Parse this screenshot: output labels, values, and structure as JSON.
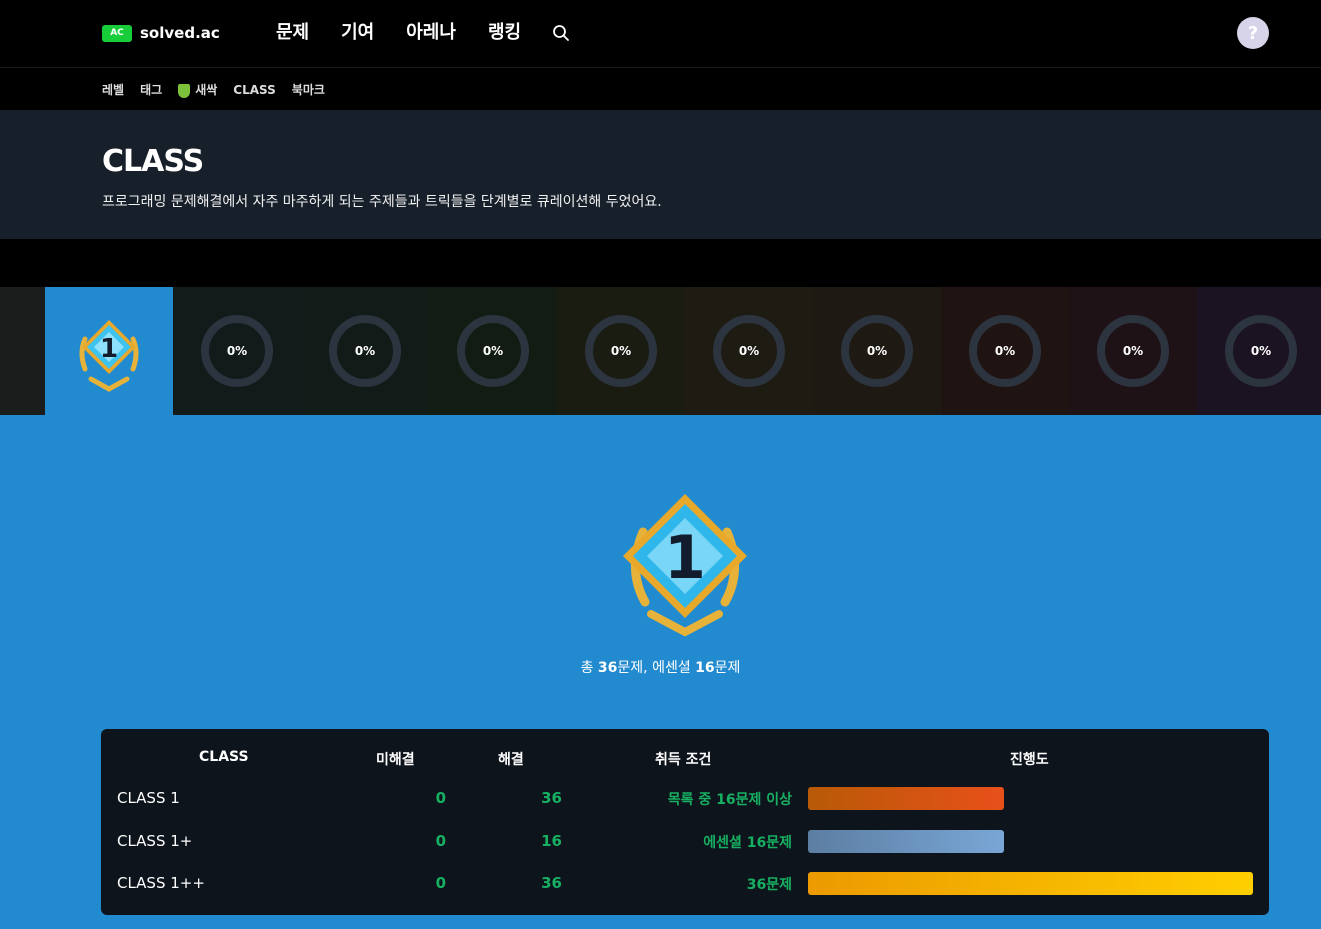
{
  "header": {
    "logo_badge": "AC",
    "logo_text": "solved.ac",
    "nav": [
      "문제",
      "기여",
      "아레나",
      "랭킹"
    ],
    "help": "?"
  },
  "subnav": {
    "items": [
      "레벨",
      "태그",
      "새싹",
      "CLASS",
      "북마크"
    ]
  },
  "hero": {
    "title": "CLASS",
    "description": "프로그래밍 문제해결에서 자주 마주하게 되는 주제들과 트릭들을 단계별로 큐레이션해 두었어요."
  },
  "class_strip": {
    "selected_number": "1",
    "progress": [
      "0%",
      "0%",
      "0%",
      "0%",
      "0%",
      "0%",
      "0%",
      "0%",
      "0%"
    ]
  },
  "detail": {
    "badge_number": "1",
    "summary": {
      "prefix": "총 ",
      "total": "36",
      "mid": "문제, 에센셜 ",
      "essential": "16",
      "suffix": "문제"
    },
    "table": {
      "headers": {
        "class": "CLASS",
        "unsolved": "미해결",
        "solved": "해결",
        "condition": "취득 조건",
        "progress": "진행도"
      },
      "rows": [
        {
          "name": "CLASS 1",
          "unsolved": "0",
          "solved": "36",
          "condition": "목록 중 16문제 이상",
          "fill": 0.44
        },
        {
          "name": "CLASS 1+",
          "unsolved": "0",
          "solved": "16",
          "condition": "에센셜 16문제",
          "fill": 0.44
        },
        {
          "name": "CLASS 1++",
          "unsolved": "0",
          "solved": "36",
          "condition": "36문제",
          "fill": 1.0
        }
      ]
    }
  },
  "colors": {
    "accent": "#228bd0",
    "solved_green": "#17b062",
    "ac_green": "#17ce3a"
  }
}
